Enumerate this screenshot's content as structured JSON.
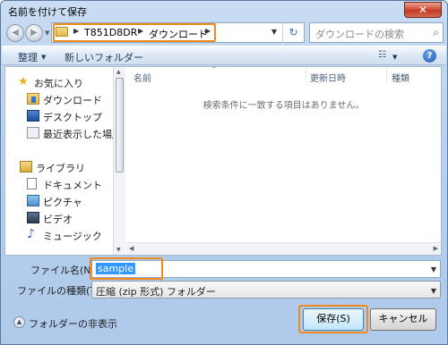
{
  "window": {
    "title": "名前を付けて保存",
    "close_label": "✕"
  },
  "nav": {
    "back_icon": "◀",
    "forward_icon": "▶",
    "history_dropdown": "▼"
  },
  "address": {
    "sep": "▶",
    "crumbs": [
      "T851D8DR",
      "ダウンロード"
    ],
    "dropdown": "▼",
    "refresh": "↻"
  },
  "search": {
    "placeholder": "ダウンロードの検索",
    "icon": "⌕"
  },
  "toolbar": {
    "organize": "整理",
    "organize_arrow": "▼",
    "new_folder": "新しいフォルダー",
    "views_icon": "☷",
    "views_arrow": "▼",
    "help": "?"
  },
  "navpane": {
    "items": [
      {
        "label": "お気に入り",
        "icon": "star-icon"
      },
      {
        "label": "ダウンロード",
        "icon": "downloads-folder-icon"
      },
      {
        "label": "デスクトップ",
        "icon": "desktop-icon"
      },
      {
        "label": "最近表示した場所",
        "icon": "recent-places-icon"
      },
      {
        "label": "ライブラリ",
        "icon": "libraries-icon"
      },
      {
        "label": "ドキュメント",
        "icon": "documents-icon"
      },
      {
        "label": "ピクチャ",
        "icon": "pictures-icon"
      },
      {
        "label": "ビデオ",
        "icon": "videos-icon"
      },
      {
        "label": "ミュージック",
        "icon": "music-icon"
      }
    ],
    "star_glyph": "★",
    "music_glyph": "♪"
  },
  "list": {
    "columns": [
      "名前",
      "更新日時",
      "種類"
    ],
    "sort_caret": "^",
    "empty_message": "検索条件に一致する項目はありません。"
  },
  "form": {
    "filename_label": "ファイル名(N):",
    "filename_value": "sample",
    "filetype_label": "ファイルの種類(T):",
    "filetype_value": "圧縮 (zip 形式) フォルダー",
    "dropdown": "▼"
  },
  "footer": {
    "hide_folders": "フォルダーの非表示",
    "hide_icon": "▲",
    "save": "保存(S)",
    "cancel": "キャンセル"
  },
  "colors": {
    "highlight": "#f08a1c",
    "selection": "#3399ff"
  }
}
